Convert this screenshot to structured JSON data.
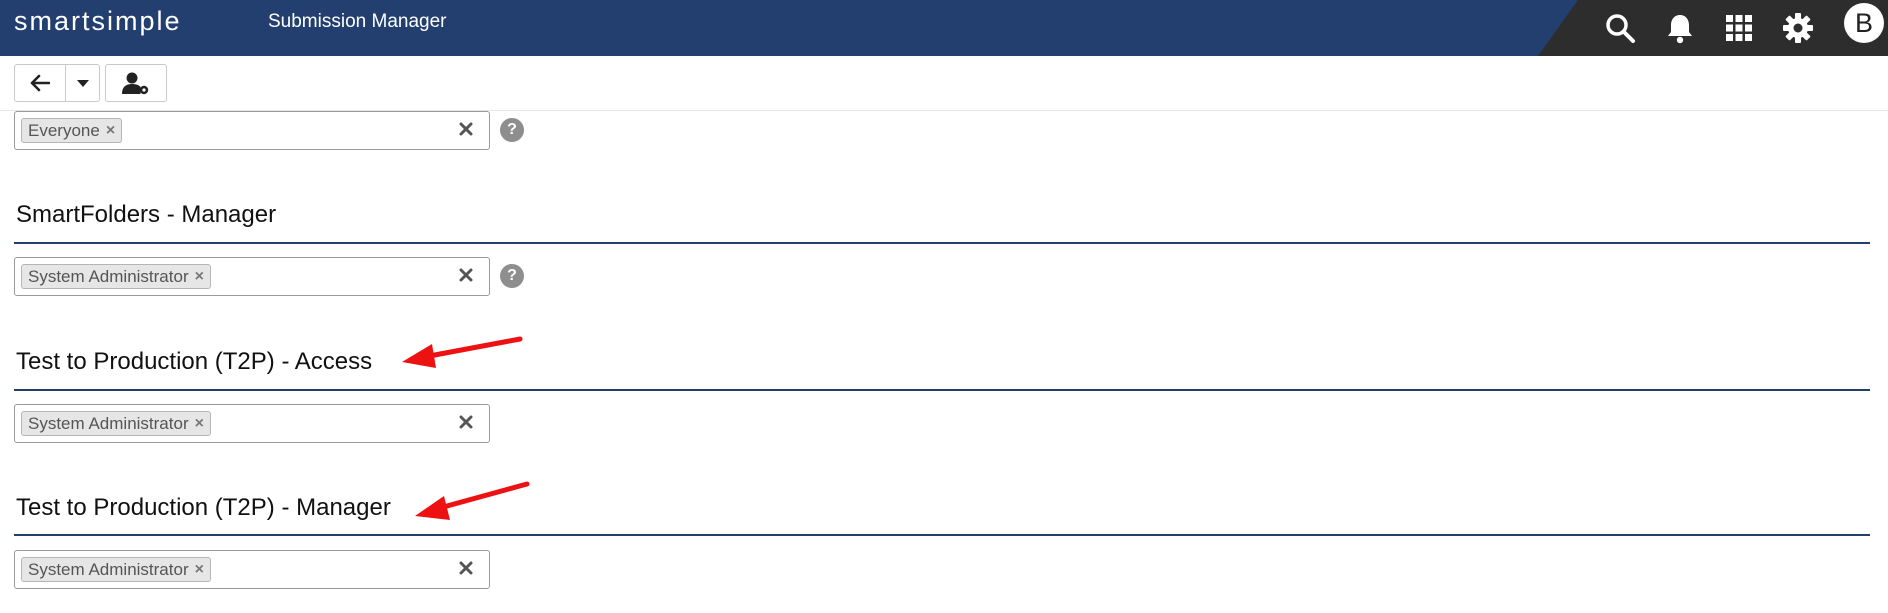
{
  "header": {
    "logo": "smartsimple",
    "title": "Submission Manager",
    "avatar_letter": "B",
    "icons": [
      "search-icon",
      "bell-icon",
      "apps-grid-icon",
      "gear-icon"
    ]
  },
  "toolbar": {
    "icons": [
      "back-arrow-icon",
      "caret-down-icon",
      "user-settings-icon"
    ]
  },
  "sections": [
    {
      "heading": "",
      "tag": "Everyone",
      "help": "?"
    },
    {
      "heading": "SmartFolders - Manager",
      "tag": "System Administrator",
      "help": "?"
    },
    {
      "heading": "Test to Production (T2P) - Access",
      "tag": "System Administrator"
    },
    {
      "heading": "Test to Production (T2P) - Manager",
      "tag": "System Administrator"
    }
  ],
  "colors": {
    "header_bg": "#233f6f",
    "header_right_bg": "#2d2d2d",
    "section_rule": "#233f6f",
    "annotation_arrow": "#ee1111"
  },
  "annotations": [
    "red-arrow",
    "red-arrow"
  ]
}
